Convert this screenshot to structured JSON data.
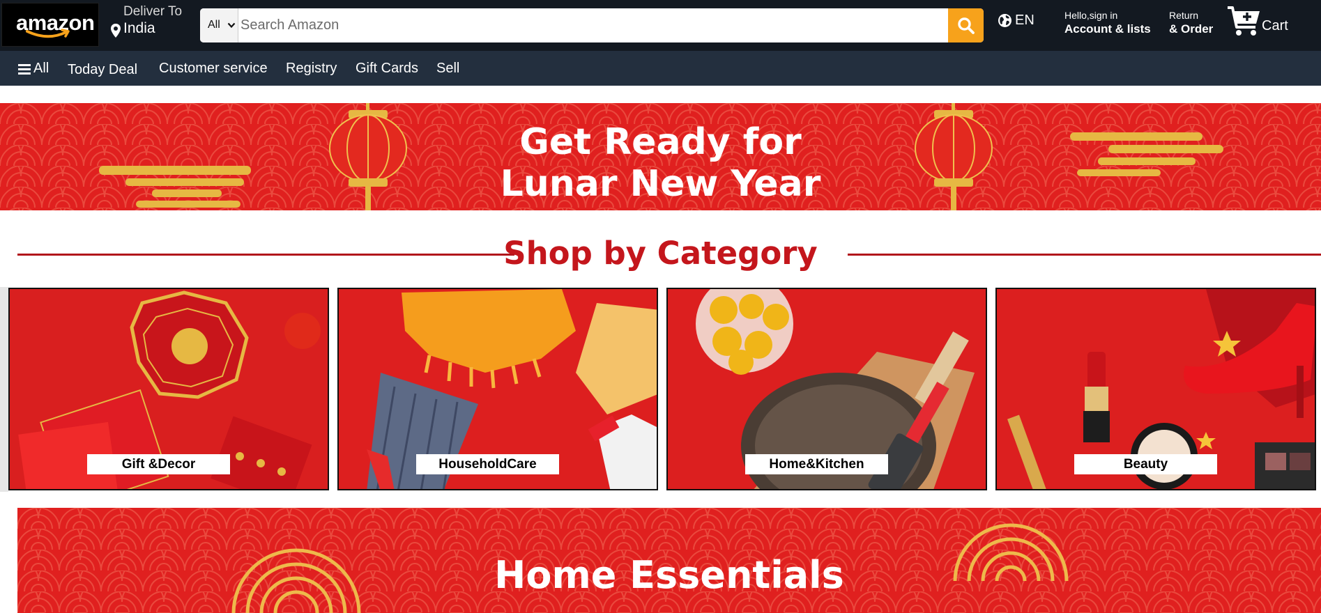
{
  "header": {
    "logo_text": "amazon",
    "deliver_label": "Deliver To",
    "deliver_location": "India",
    "search_category": "All",
    "search_placeholder": "Search Amazon",
    "language": "EN",
    "account_greeting": "Hello,sign in",
    "account_label": "Account & lists",
    "returns_line1": "Return",
    "returns_line2": "& Order",
    "cart_label": "Cart"
  },
  "subnav": {
    "all": "All",
    "items": [
      "Today Deal",
      "Customer service",
      "Registry",
      "Gift Cards",
      "Sell"
    ]
  },
  "hero_banner": {
    "line1": "Get Ready for",
    "line2": "Lunar New Year"
  },
  "category_section": {
    "title": "Shop by Category",
    "categories": [
      {
        "label": "Gift &Decor"
      },
      {
        "label": "HouseholdCare"
      },
      {
        "label": "Home&Kitchen"
      },
      {
        "label": "Beauty"
      }
    ]
  },
  "bottom_banner": {
    "title": "Home Essentials"
  },
  "colors": {
    "nav_dark": "#131921",
    "subnav": "#232f3e",
    "search_button": "#f7a21b",
    "banner_red": "#e0201f",
    "title_red": "#c4161c"
  }
}
